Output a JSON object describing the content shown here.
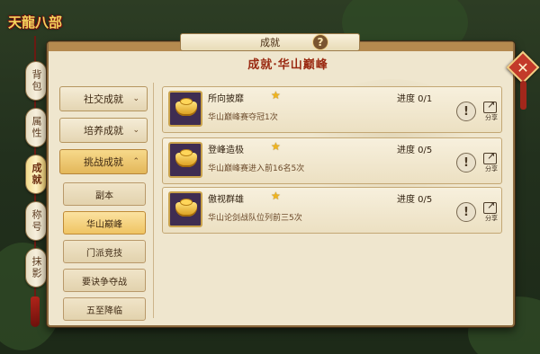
{
  "game": {
    "logo_text": "天龍八部"
  },
  "window": {
    "title": "成就",
    "banner": "成就·华山巅峰"
  },
  "side_tabs": [
    {
      "label": "背包",
      "active": false
    },
    {
      "label": "属性",
      "active": false
    },
    {
      "label": "成就",
      "active": true
    },
    {
      "label": "称号",
      "active": false
    },
    {
      "label": "抹影",
      "active": false
    }
  ],
  "categories": [
    {
      "label": "社交成就",
      "arrow": "⌄"
    },
    {
      "label": "培养成就",
      "arrow": "⌄"
    },
    {
      "label": "挑战成就",
      "arrow": "⌃"
    }
  ],
  "subcategories": [
    {
      "label": "副本",
      "selected": false
    },
    {
      "label": "华山巅峰",
      "selected": true
    },
    {
      "label": "门派竞技",
      "selected": false
    },
    {
      "label": "要诀争夺战",
      "selected": false
    },
    {
      "label": "五至降临",
      "selected": false
    }
  ],
  "achievements": [
    {
      "name": "所向披靡",
      "desc": "华山巅峰赛夺冠1次",
      "progress": "进度 0/1",
      "share": "分享"
    },
    {
      "name": "登峰造极",
      "desc": "华山巅峰赛进入前16名5次",
      "progress": "进度 0/5",
      "share": "分享"
    },
    {
      "name": "傲视群雄",
      "desc": "华山论剑战队位列前三5次",
      "progress": "进度 0/5",
      "share": "分享"
    }
  ],
  "icons": {
    "help": "?",
    "close": "✕",
    "warn": "!",
    "star": "★",
    "share_arrow": "↗"
  },
  "colors": {
    "accent_red": "#9a2a12",
    "gold": "#f0b41c",
    "panel_bg": "#efe6ce"
  }
}
